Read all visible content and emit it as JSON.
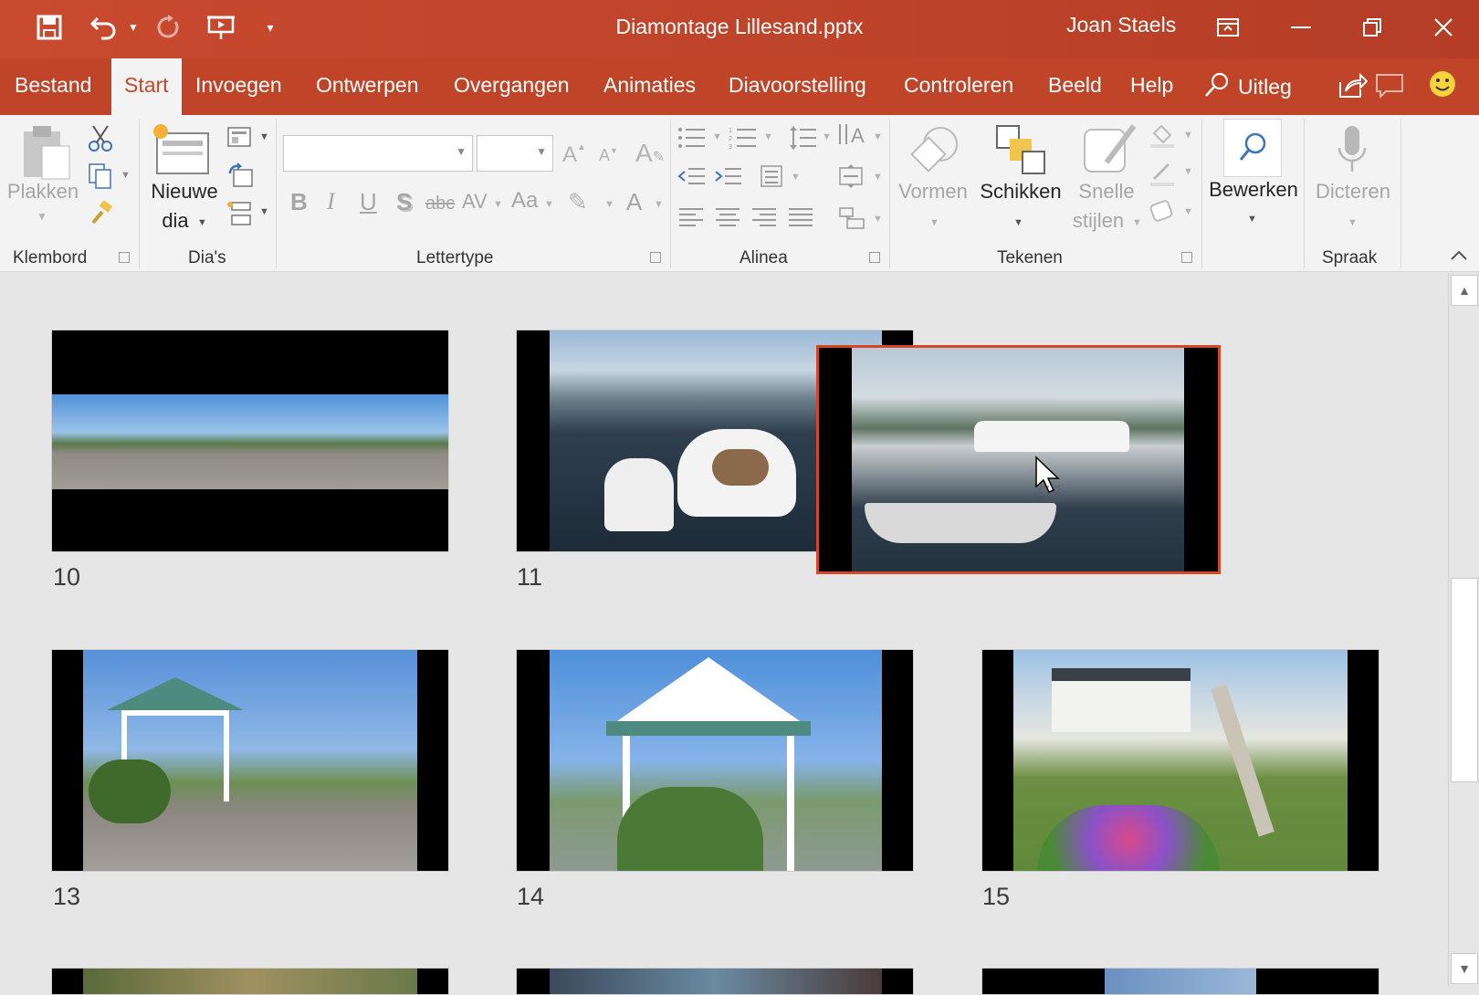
{
  "window": {
    "title": "Diamontage Lillesand.pptx",
    "user": "Joan Staels"
  },
  "tabs": [
    {
      "label": "Bestand"
    },
    {
      "label": "Start"
    },
    {
      "label": "Invoegen"
    },
    {
      "label": "Ontwerpen"
    },
    {
      "label": "Overgangen"
    },
    {
      "label": "Animaties"
    },
    {
      "label": "Diavoorstelling"
    },
    {
      "label": "Controleren"
    },
    {
      "label": "Beeld"
    },
    {
      "label": "Help"
    },
    {
      "label": "Uitleg"
    }
  ],
  "ribbon": {
    "paste_label": "Plakken",
    "new_slide_label_1": "Nieuwe",
    "new_slide_label_2": "dia",
    "shapes_label": "Vormen",
    "arrange_label": "Schikken",
    "quick_styles_1": "Snelle",
    "quick_styles_2": "stijlen",
    "edit_label": "Bewerken",
    "dictate_label": "Dicteren",
    "groups": {
      "clipboard": "Klembord",
      "slides": "Dia's",
      "font": "Lettertype",
      "paragraph": "Alinea",
      "drawing": "Tekenen",
      "speech": "Spraak"
    },
    "format_buttons": [
      "B",
      "I",
      "U",
      "S",
      "abc",
      "AV",
      "Aa",
      "A"
    ]
  },
  "slides": [
    {
      "number": "10"
    },
    {
      "number": "11"
    },
    {
      "number": "13"
    },
    {
      "number": "14"
    },
    {
      "number": "15"
    }
  ],
  "colors": {
    "accent": "#bf4428",
    "ribbon_bg": "#f3f3f3",
    "selection_border": "#d24726"
  }
}
